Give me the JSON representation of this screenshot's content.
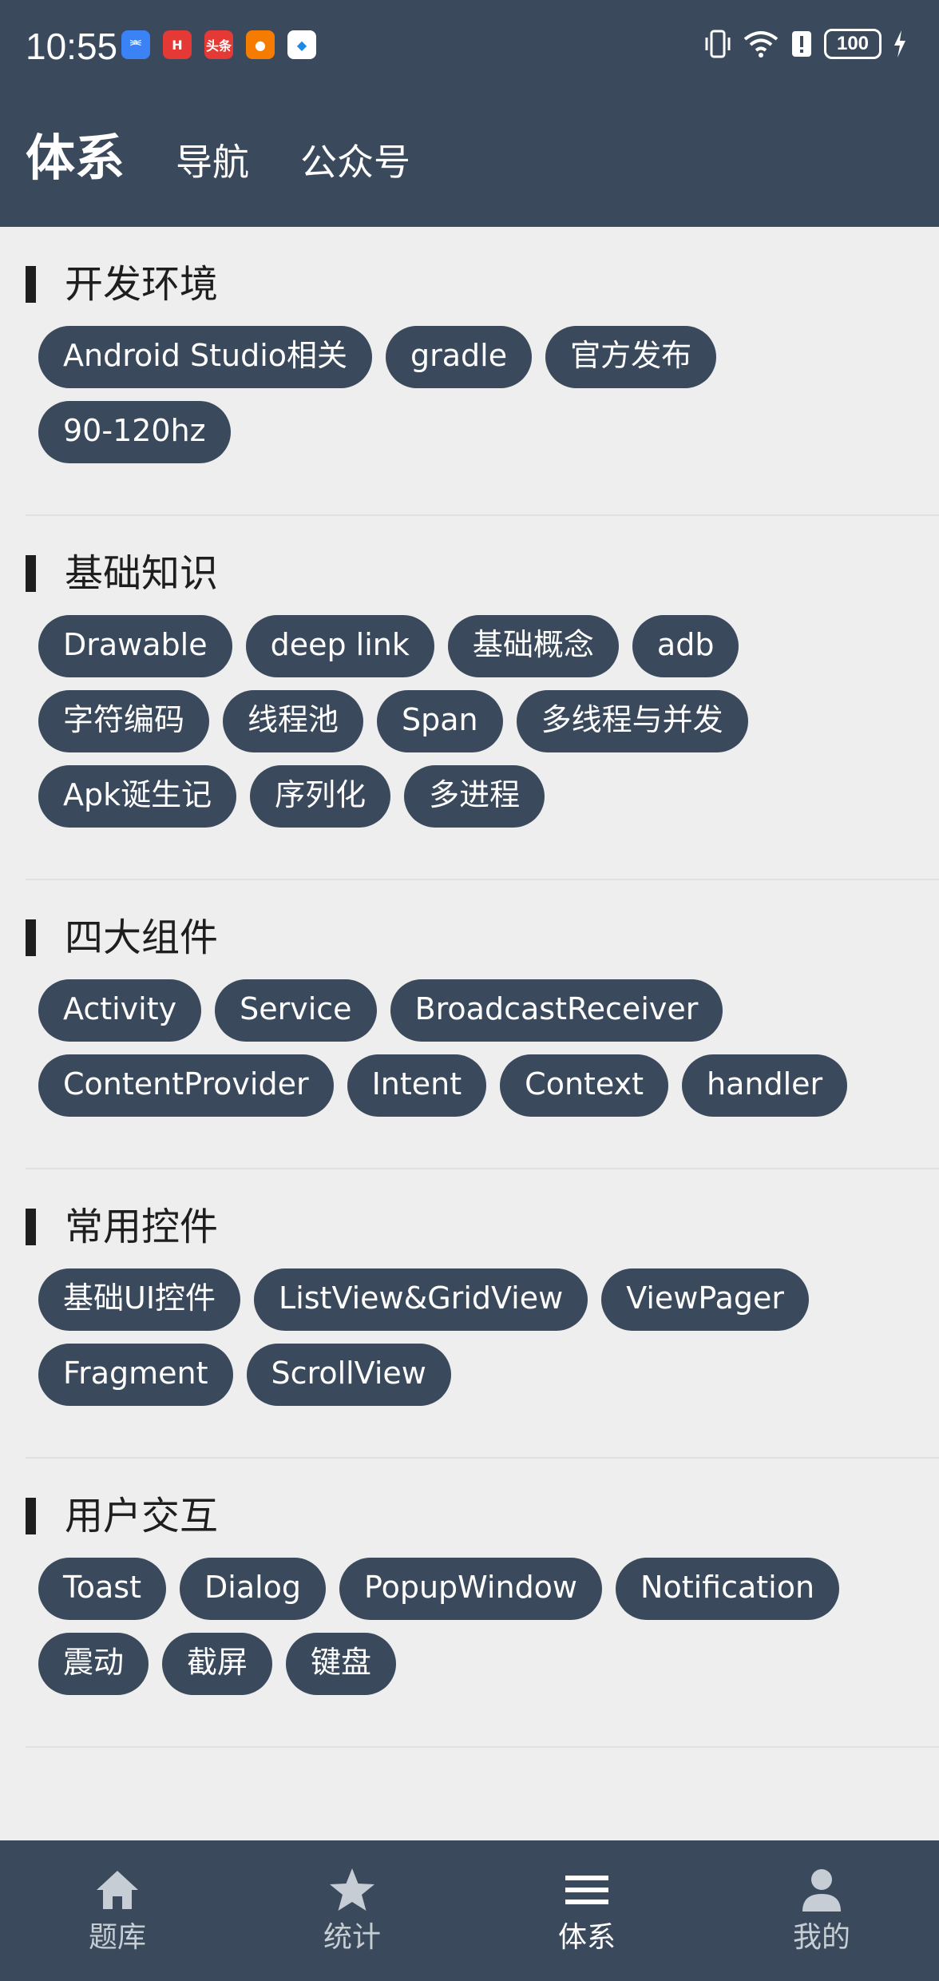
{
  "status_bar": {
    "time": "10:55",
    "battery": "100",
    "notifications": [
      {
        "name": "usb-icon",
        "color": "#3b82f6",
        "glyph": "⎃"
      },
      {
        "name": "huawei-app-icon",
        "color": "#e53935",
        "glyph": "H"
      },
      {
        "name": "toutiao-icon",
        "color": "#e53935",
        "glyph": "头条"
      },
      {
        "name": "orange-app-icon",
        "color": "#f57c00",
        "glyph": "●"
      },
      {
        "name": "blue-app-icon",
        "color": "#ffffff",
        "glyph": "◆"
      }
    ]
  },
  "header": {
    "tabs": [
      {
        "label": "体系",
        "active": true
      },
      {
        "label": "导航",
        "active": false
      },
      {
        "label": "公众号",
        "active": false
      }
    ]
  },
  "sections": [
    {
      "title": "开发环境",
      "chips": [
        "Android Studio相关",
        "gradle",
        "官方发布",
        "90-120hz"
      ]
    },
    {
      "title": "基础知识",
      "chips": [
        "Drawable",
        "deep link",
        "基础概念",
        "adb",
        "字符编码",
        "线程池",
        "Span",
        "多线程与并发",
        "Apk诞生记",
        "序列化",
        "多进程"
      ]
    },
    {
      "title": "四大组件",
      "chips": [
        "Activity",
        "Service",
        "BroadcastReceiver",
        "ContentProvider",
        "Intent",
        "Context",
        "handler"
      ]
    },
    {
      "title": "常用控件",
      "chips": [
        "基础UI控件",
        "ListView&GridView",
        "ViewPager",
        "Fragment",
        "ScrollView"
      ]
    },
    {
      "title": "用户交互",
      "chips": [
        "Toast",
        "Dialog",
        "PopupWindow",
        "Notification",
        "震动",
        "截屏",
        "键盘"
      ]
    }
  ],
  "bottom_nav": [
    {
      "label": "题库",
      "icon": "home-icon",
      "active": false
    },
    {
      "label": "统计",
      "icon": "star-icon",
      "active": false
    },
    {
      "label": "体系",
      "icon": "menu-icon",
      "active": true
    },
    {
      "label": "我的",
      "icon": "person-icon",
      "active": false
    }
  ],
  "colors": {
    "primary": "#3a4a5c",
    "background": "#eeeeee",
    "text": "#1e1e1e"
  }
}
